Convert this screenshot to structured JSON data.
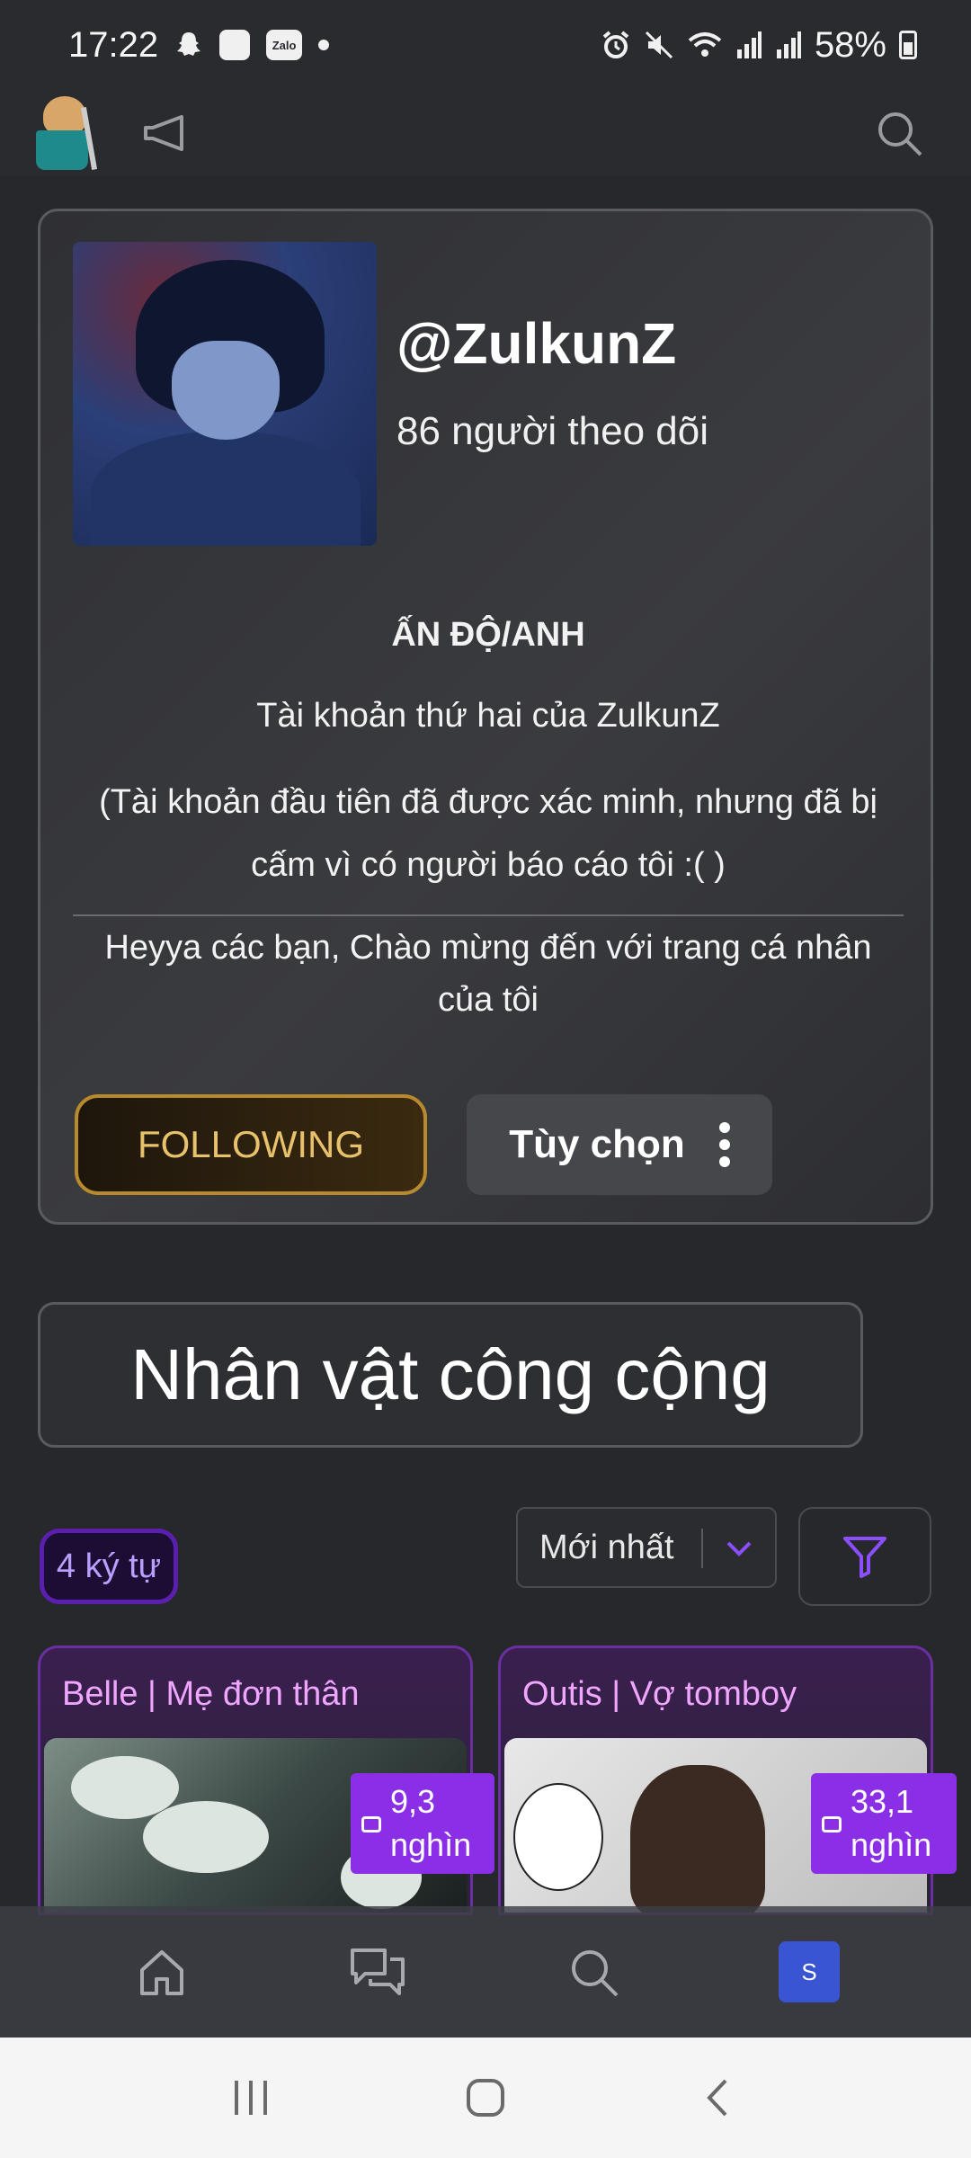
{
  "status_bar": {
    "time": "17:22",
    "battery": "58%",
    "zalo_label": "Zalo",
    "icons": [
      "snapchat-icon",
      "messenger-icon",
      "zalo-icon",
      "dot-icon",
      "alarm-icon",
      "mute-icon",
      "wifi-icon",
      "signal-icon",
      "signal-icon",
      "battery-icon"
    ]
  },
  "app_bar": {
    "icons": [
      "logo-icon",
      "megaphone-icon",
      "search-icon"
    ]
  },
  "profile": {
    "username": "@ZulkunZ",
    "followers": "86 người theo dõi",
    "bio_title": "ẤN ĐỘ/ANH",
    "bio_line1": "Tài khoản thứ hai của ZulkunZ",
    "bio_line2": "(Tài khoản đầu tiên đã được xác minh, nhưng đã bị cấm vì có người báo cáo tôi :( )",
    "bio_line3": "Heyya các bạn, Chào mừng đến với trang cá nhân của tôi",
    "following_label": "FOLLOWING",
    "options_label": "Tùy chọn"
  },
  "section": {
    "title": "Nhân vật công cộng",
    "count": "4 ký tự",
    "sort_value": "Mới nhất"
  },
  "characters": [
    {
      "name": "Belle | Mẹ đơn thân",
      "stat_value": "9,3",
      "stat_unit": "nghìn"
    },
    {
      "name": "Outis | Vợ tomboy",
      "stat_value": "33,1",
      "stat_unit": "nghìn"
    }
  ],
  "bottom_nav": {
    "items": [
      "home-icon",
      "chat-icon",
      "search-icon",
      "profile-icon"
    ],
    "profile_initial": "S"
  },
  "colors": {
    "background": "#27282c",
    "following_gold": "#e8c16b",
    "accent_purple": "#8b2fe6",
    "card_name_pink": "#f0a6ff",
    "profile_blue": "#3a55d1"
  }
}
